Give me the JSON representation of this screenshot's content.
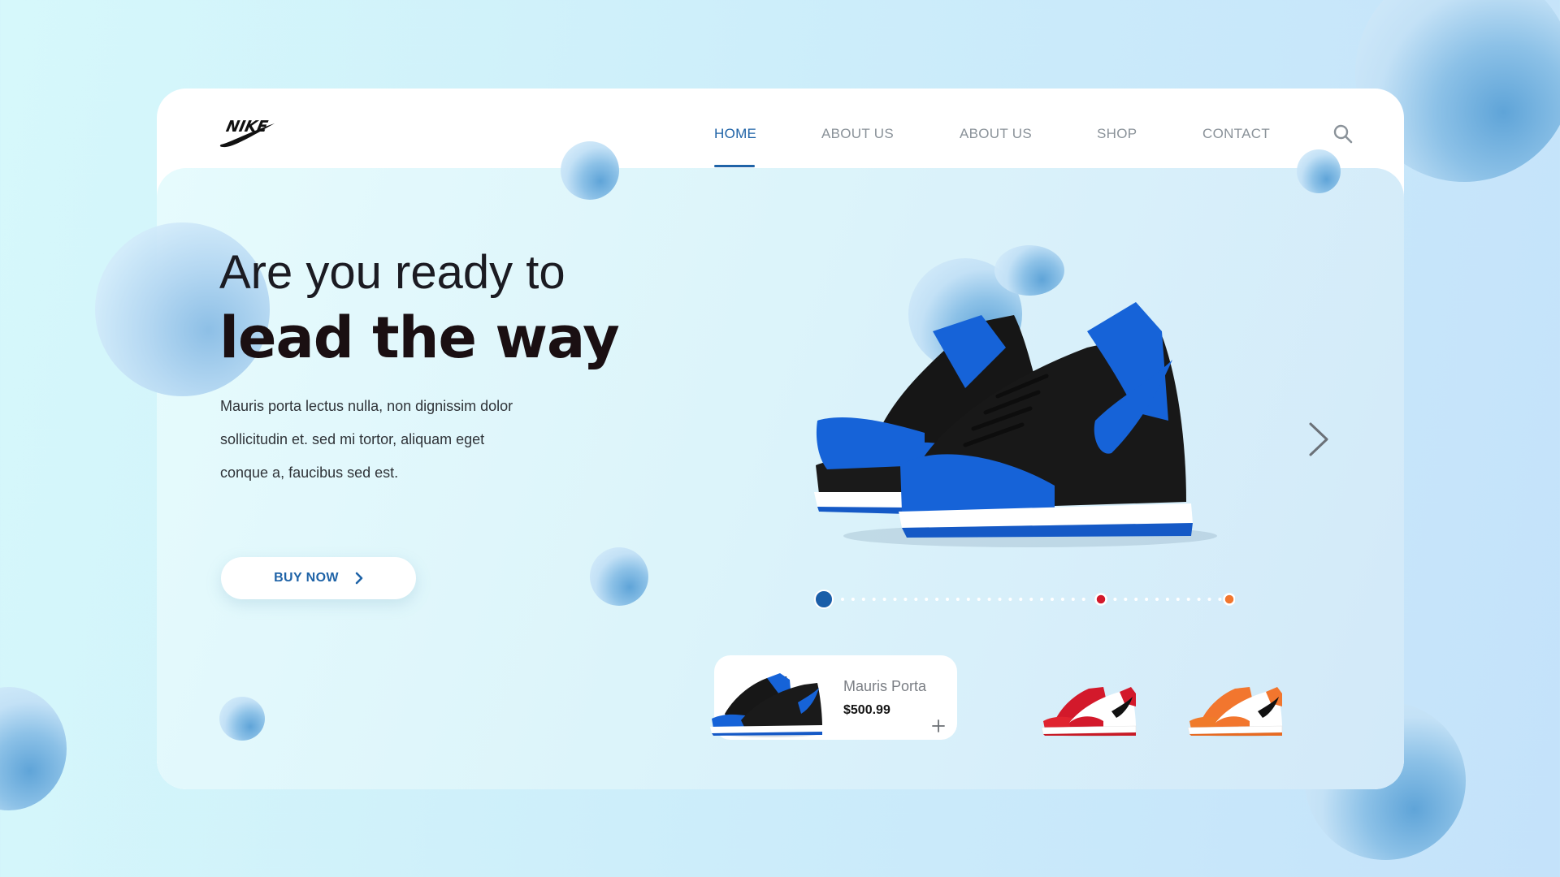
{
  "brand": {
    "logo_text": "NIKE"
  },
  "nav": {
    "items": [
      {
        "label": "HOME",
        "active": true
      },
      {
        "label": "ABOUT US",
        "active": false
      },
      {
        "label": "ABOUT US",
        "active": false
      },
      {
        "label": "SHOP",
        "active": false
      },
      {
        "label": "CONTACT",
        "active": false
      }
    ],
    "search_icon": "search-icon"
  },
  "hero": {
    "headline_line1": "Are you ready to",
    "headline_line2": "lead the way",
    "description_lines": [
      "Mauris porta lectus nulla, non dignissim dolor",
      "sollicitudin et. sed mi tortor, aliquam eget",
      "conque a, faucibus sed est."
    ],
    "cta_label": "BUY NOW",
    "cta_icon": "chevron-right-icon",
    "next_icon": "chevron-right-icon"
  },
  "carousel": {
    "active_index": 0,
    "markers": [
      {
        "color": "#1a5ea8"
      },
      {
        "color": "#d3192b"
      },
      {
        "color": "#f2762e"
      }
    ]
  },
  "products": {
    "featured": {
      "name": "Mauris Porta",
      "price": "$500.99",
      "add_icon": "plus-icon"
    },
    "thumbnails": [
      {
        "colorway": "blue-black"
      },
      {
        "colorway": "red-white"
      },
      {
        "colorway": "orange-white"
      }
    ]
  },
  "colors": {
    "accent": "#1f63a7",
    "heading": "#1a0f12",
    "nav_inactive": "#8a9299",
    "card": "#ffffff"
  }
}
